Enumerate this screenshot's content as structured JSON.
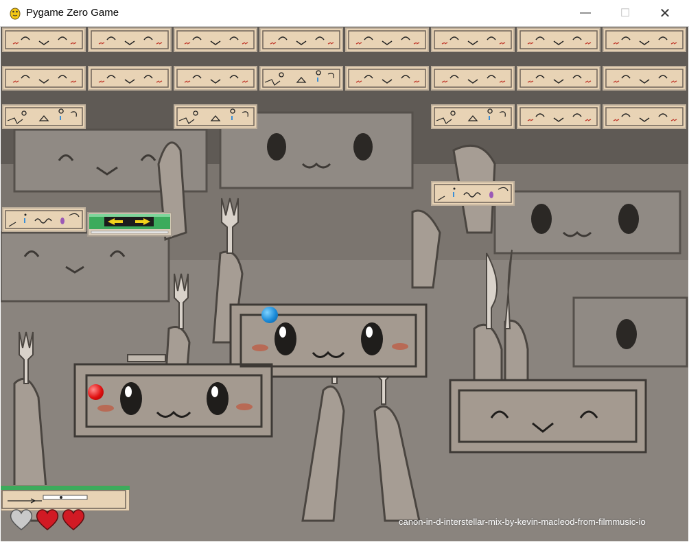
{
  "window": {
    "title": "Pygame Zero Game",
    "controls": {
      "minimize": "—",
      "maximize": "☐",
      "close": "✕"
    }
  },
  "game": {
    "bricks": [
      {
        "row": 0,
        "col": 0,
        "type": "smile"
      },
      {
        "row": 0,
        "col": 1,
        "type": "smile"
      },
      {
        "row": 0,
        "col": 2,
        "type": "smile"
      },
      {
        "row": 0,
        "col": 3,
        "type": "smile"
      },
      {
        "row": 0,
        "col": 4,
        "type": "smile"
      },
      {
        "row": 0,
        "col": 5,
        "type": "smile"
      },
      {
        "row": 0,
        "col": 6,
        "type": "smile"
      },
      {
        "row": 0,
        "col": 7,
        "type": "smile"
      },
      {
        "row": 1,
        "col": 0,
        "type": "smile"
      },
      {
        "row": 1,
        "col": 1,
        "type": "smile"
      },
      {
        "row": 1,
        "col": 2,
        "type": "smile"
      },
      {
        "row": 1,
        "col": 3,
        "type": "cracked"
      },
      {
        "row": 1,
        "col": 4,
        "type": "smile"
      },
      {
        "row": 1,
        "col": 5,
        "type": "smile"
      },
      {
        "row": 1,
        "col": 6,
        "type": "smile"
      },
      {
        "row": 1,
        "col": 7,
        "type": "smile"
      },
      {
        "row": 2,
        "col": 0,
        "type": "cracked"
      },
      {
        "row": 2,
        "col": 2,
        "type": "cracked"
      },
      {
        "row": 2,
        "col": 5,
        "type": "cracked"
      },
      {
        "row": 2,
        "col": 6,
        "type": "smile"
      },
      {
        "row": 2,
        "col": 7,
        "type": "smile"
      },
      {
        "row": 4,
        "col": 5,
        "type": "wavy"
      },
      {
        "row": 5,
        "col": 0,
        "type": "wavy"
      }
    ],
    "balls": [
      {
        "color": "blue"
      },
      {
        "color": "red"
      }
    ],
    "powerup": {
      "name": "expand-paddle",
      "icon": "left-right-arrows-icon"
    },
    "lives": {
      "remaining": 2,
      "max": 3
    },
    "music_credit": "canon-in-d-interstellar-mix-by-kevin-macleod-from-filmmusic-io"
  },
  "colors": {
    "brick": "#e8d3b5",
    "brick_border": "#bfb09c",
    "heart_full": "#d11a24",
    "heart_empty": "#c9c9c9",
    "paddle_green": "#3cab5c"
  }
}
